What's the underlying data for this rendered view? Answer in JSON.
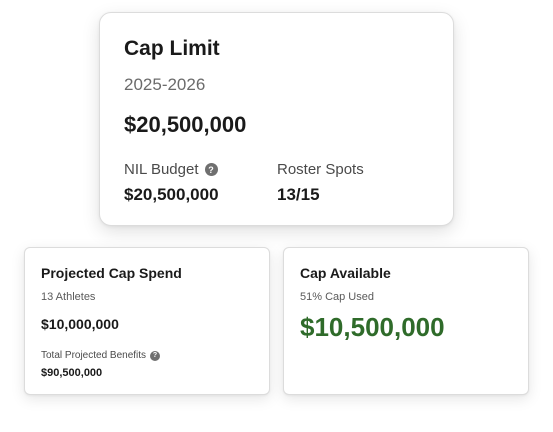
{
  "cap_limit": {
    "title": "Cap Limit",
    "season": "2025-2026",
    "amount": "$20,500,000",
    "nil_budget_label": "NIL Budget",
    "nil_budget_value": "$20,500,000",
    "roster_spots_label": "Roster Spots",
    "roster_spots_value": "13/15",
    "help_icon": "?"
  },
  "projected_cap_spend": {
    "title": "Projected Cap Spend",
    "athletes": "13 Athletes",
    "amount": "$10,000,000",
    "benefits_label": "Total Projected Benefits",
    "benefits_value": "$90,500,000",
    "help_icon": "?"
  },
  "cap_available": {
    "title": "Cap Available",
    "cap_used": "51% Cap Used",
    "amount": "$10,500,000"
  },
  "colors": {
    "accent_green": "#2f6b2a",
    "help_icon_bg": "#6f6f6f"
  }
}
